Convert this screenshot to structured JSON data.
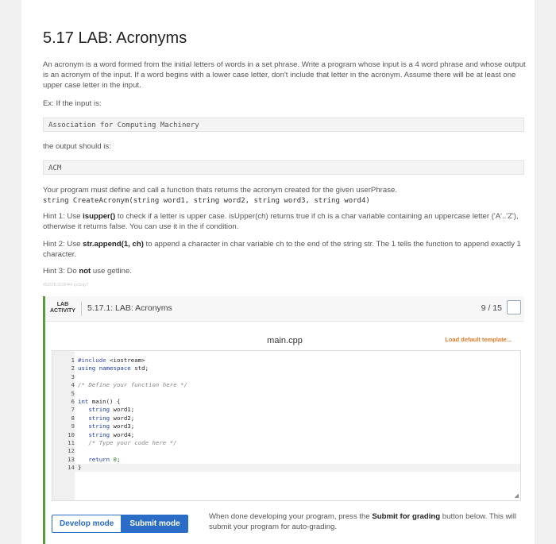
{
  "title": "5.17 LAB: Acronyms",
  "intro": "An acronym is a word formed from the initial letters of words in a set phrase. Write a program whose input is a 4 word phrase and whose output is an acronym of the input. If a word begins with a lower case letter, don't include that letter in the acronym. Assume there will be at least one upper case letter in the input.",
  "ex_label": "Ex: If the input is:",
  "ex_input": "Association for Computing Machinery",
  "output_label": "the output should is:",
  "ex_output": "ACM",
  "define_text": "Your program must define and call a function thats returns the acronym created for the given userPhrase.",
  "signature": "string CreateAcronym(string word1, string word2, string word3, string word4)",
  "hint1_pre": "Hint 1: Use ",
  "hint1_bold": "isupper()",
  "hint1_post": " to check if a letter is upper case. isUpper(ch) returns true if ch is a char variable containing an uppercase letter ('A'..'Z'), otherwise it returns false. You can use it in the if condition.",
  "hint2_pre": "Hint 2: Use ",
  "hint2_bold": "str.append(1, ch)",
  "hint2_post": " to append a character in char variable ch to the end of the string str. The 1 tells the function to append exactly 1 character.",
  "hint3_pre": "Hint 3: Do ",
  "hint3_bold": "not",
  "hint3_post": " use getline.",
  "meta_id": "452678.3216444.qx3zqy7",
  "lab": {
    "tag_line1": "LAB",
    "tag_line2": "ACTIVITY",
    "title": "5.17.1: LAB: Acronyms",
    "score": "9 / 15",
    "filename": "main.cpp",
    "load_template": "Load default template...",
    "develop_mode": "Develop mode",
    "submit_mode": "Submit mode",
    "note_pre": "When done developing your program, press the ",
    "note_bold": "Submit for grading",
    "note_post": " button below. This will submit your program for auto-grading."
  },
  "code_lines": [
    "#include <iostream>",
    "using namespace std;",
    "",
    "/* Define your function here */",
    "",
    "int main() {",
    "   string word1;",
    "   string word2;",
    "   string word3;",
    "   string word4;",
    "   /* Type your code here */",
    "",
    "   return 0;",
    "}"
  ]
}
